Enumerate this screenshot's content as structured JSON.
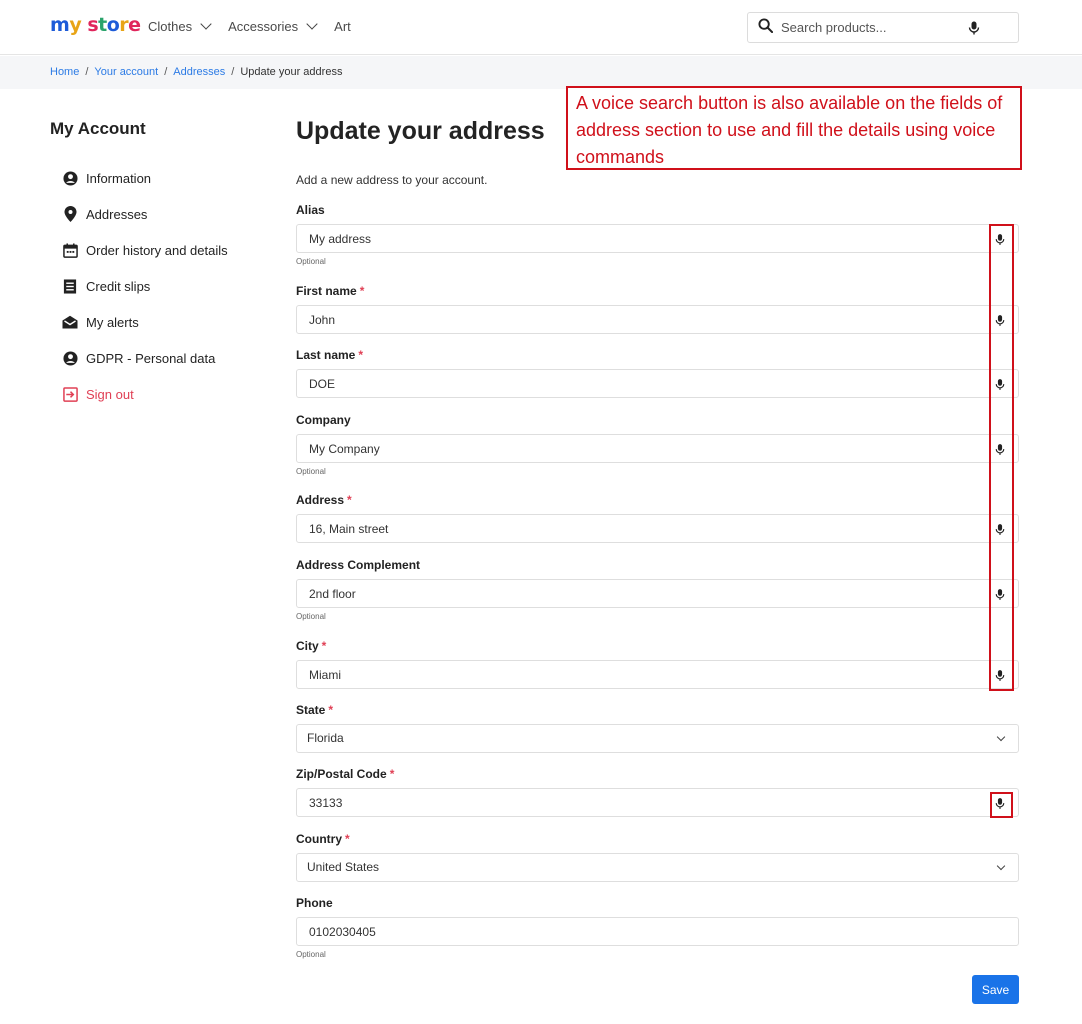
{
  "header": {
    "logo_text": "my store",
    "nav": [
      {
        "label": "Clothes",
        "dropdown": true
      },
      {
        "label": "Accessories",
        "dropdown": true
      },
      {
        "label": "Art",
        "dropdown": false
      }
    ],
    "search_placeholder": "Search products..."
  },
  "breadcrumb": {
    "home": "Home",
    "account": "Your account",
    "addresses": "Addresses",
    "current": "Update your address",
    "separator": "/"
  },
  "sidebar": {
    "title": "My Account",
    "items": [
      {
        "label": "Information",
        "icon": "user-circle-icon"
      },
      {
        "label": "Addresses",
        "icon": "map-pin-icon"
      },
      {
        "label": "Order history and details",
        "icon": "calendar-icon"
      },
      {
        "label": "Credit slips",
        "icon": "receipt-icon"
      },
      {
        "label": "My alerts",
        "icon": "mail-open-icon"
      },
      {
        "label": "GDPR - Personal data",
        "icon": "user-circle-icon"
      },
      {
        "label": "Sign out",
        "icon": "sign-out-icon"
      }
    ]
  },
  "main": {
    "title": "Update your address",
    "intro": "Add a new address to your account.",
    "required_mark": "*",
    "optional_label": "Optional",
    "fields": {
      "alias": {
        "label": "Alias",
        "value": "My address"
      },
      "firstname": {
        "label": "First name",
        "value": "John"
      },
      "lastname": {
        "label": "Last name",
        "value": "DOE"
      },
      "company": {
        "label": "Company",
        "value": "My Company"
      },
      "address": {
        "label": "Address",
        "value": "16, Main street"
      },
      "address2": {
        "label": "Address Complement",
        "value": "2nd floor"
      },
      "city": {
        "label": "City",
        "value": "Miami"
      },
      "state": {
        "label": "State",
        "value": "Florida"
      },
      "zip": {
        "label": "Zip/Postal Code",
        "value": "33133"
      },
      "country": {
        "label": "Country",
        "value": "United States"
      },
      "phone": {
        "label": "Phone",
        "value": "0102030405"
      }
    },
    "save_label": "Save"
  },
  "annotation": {
    "text": "A voice search button is also available on the fields of address section to use and fill the details using voice commands",
    "color": "#d0101a"
  },
  "colors": {
    "link": "#2c7be5",
    "required": "#e04055",
    "primary_button": "#1a73e8"
  }
}
